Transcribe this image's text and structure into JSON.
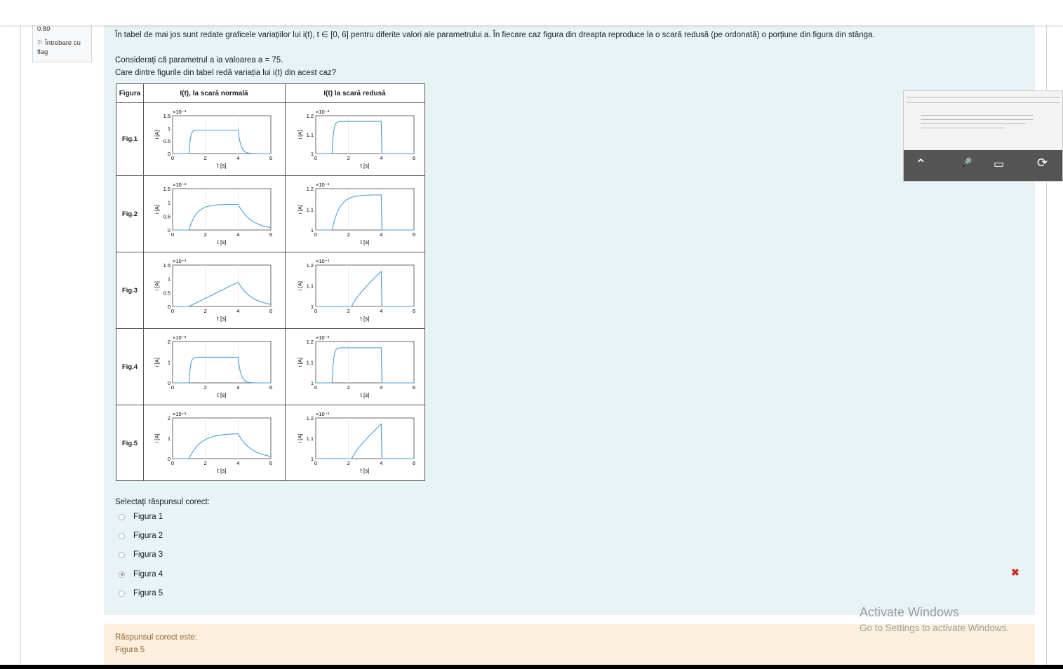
{
  "question_info": {
    "grade": "0.80",
    "flag_label": "Întrebare cu flag"
  },
  "question": {
    "intro": "În tabel de mai jos sunt redate graficele variațiilor lui i(t), t ∈ [0, 6] pentru diferite valori ale parametrului a. În fiecare caz figura din dreapta reproduce la o scară redusă (pe ordonată) o porțiune din figura din stânga.",
    "line2": "Considerați că parametrul a ia valoarea a = 75.",
    "line3": "Care dintre figurile din tabel redă variația lui i(t) din acest caz?",
    "prompt": "Selectați răspunsul corect:"
  },
  "table": {
    "headers": [
      "Figura",
      "I(t), la scară normală",
      "I(t) la scară redusă"
    ],
    "row_labels": [
      "Fig.1",
      "Fig.2",
      "Fig.3",
      "Fig.4",
      "Fig.5"
    ],
    "axis_label_x": "t [s]",
    "axis_label_y": "i [A]",
    "multiplier": "×10⁻³"
  },
  "options": [
    {
      "label": "Figura 1",
      "selected": false
    },
    {
      "label": "Figura 2",
      "selected": false
    },
    {
      "label": "Figura 3",
      "selected": false
    },
    {
      "label": "Figura 4",
      "selected": true
    },
    {
      "label": "Figura 5",
      "selected": false
    }
  ],
  "result": {
    "incorrect_icon": "close-icon",
    "color": "#ca3120"
  },
  "feedback": {
    "title": "Răspunsul corect este:",
    "answer": "Figura 5"
  },
  "watermark": {
    "line1": "Activate Windows",
    "line2": "Go to Settings to activate Windows."
  },
  "colors": {
    "question_bg": "#e7f3f5",
    "feedback_bg": "#fcefdc",
    "curve": "#4a9fd8"
  }
}
